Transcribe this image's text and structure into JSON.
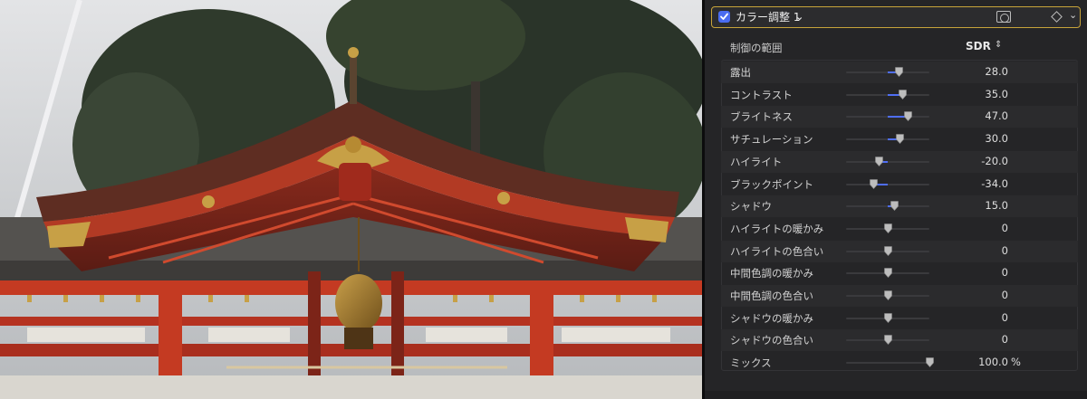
{
  "effect": {
    "title": "カラー調整 1",
    "enabled": true
  },
  "range": {
    "label": "制御の範囲",
    "value": "SDR"
  },
  "params": [
    {
      "label": "露出",
      "value": "28.0",
      "unit": "",
      "level": 0.64,
      "center": 0.5
    },
    {
      "label": "コントラスト",
      "value": "35.0",
      "unit": "",
      "level": 0.68,
      "center": 0.5
    },
    {
      "label": "ブライトネス",
      "value": "47.0",
      "unit": "",
      "level": 0.74,
      "center": 0.5
    },
    {
      "label": "サチュレーション",
      "value": "30.0",
      "unit": "",
      "level": 0.65,
      "center": 0.5
    },
    {
      "label": "ハイライト",
      "value": "-20.0",
      "unit": "",
      "level": 0.4,
      "center": 0.5
    },
    {
      "label": "ブラックポイント",
      "value": "-34.0",
      "unit": "",
      "level": 0.33,
      "center": 0.5
    },
    {
      "label": "シャドウ",
      "value": "15.0",
      "unit": "",
      "level": 0.58,
      "center": 0.5
    },
    {
      "label": "ハイライトの暖かみ",
      "value": "0",
      "unit": "",
      "level": 0.5,
      "center": 0.5
    },
    {
      "label": "ハイライトの色合い",
      "value": "0",
      "unit": "",
      "level": 0.5,
      "center": 0.5
    },
    {
      "label": "中間色調の暖かみ",
      "value": "0",
      "unit": "",
      "level": 0.5,
      "center": 0.5
    },
    {
      "label": "中間色調の色合い",
      "value": "0",
      "unit": "",
      "level": 0.5,
      "center": 0.5
    },
    {
      "label": "シャドウの暖かみ",
      "value": "0",
      "unit": "",
      "level": 0.5,
      "center": 0.5
    },
    {
      "label": "シャドウの色合い",
      "value": "0",
      "unit": "",
      "level": 0.5,
      "center": 0.5
    },
    {
      "label": "ミックス",
      "value": "100.0",
      "unit": "%",
      "level": 1.0,
      "center": 1.0
    }
  ],
  "colors": {
    "accent": "#4f6ef5",
    "header_border": "#c8a43a",
    "panel": "#252527"
  }
}
